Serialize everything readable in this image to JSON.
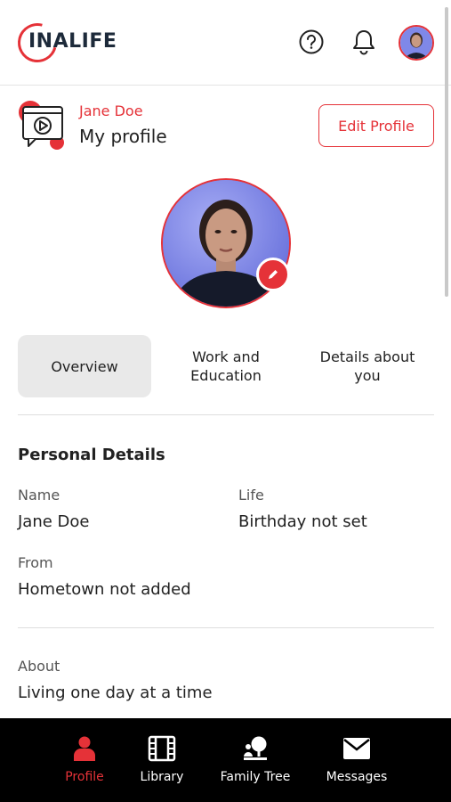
{
  "app": {
    "logo_text": "INALIFE"
  },
  "header": {
    "help_icon": "question-circle-icon",
    "notification_icon": "bell-icon"
  },
  "profile_header": {
    "user_name": "Jane Doe",
    "title": "My profile",
    "edit_button": "Edit Profile"
  },
  "tabs": [
    {
      "label": "Overview",
      "active": true
    },
    {
      "label": "Work and Education",
      "active": false
    },
    {
      "label": "Details about you",
      "active": false
    }
  ],
  "personal_details": {
    "title": "Personal Details",
    "name_label": "Name",
    "name_value": "Jane Doe",
    "life_label": "Life",
    "life_value": "Birthday not set",
    "from_label": "From",
    "from_value": "Hometown not added",
    "about_label": "About",
    "about_value": "Living one day at a time"
  },
  "bottom_nav": [
    {
      "label": "Profile",
      "icon": "person-icon",
      "active": true
    },
    {
      "label": "Library",
      "icon": "film-icon",
      "active": false
    },
    {
      "label": "Family Tree",
      "icon": "family-tree-icon",
      "active": false
    },
    {
      "label": "Messages",
      "icon": "envelope-icon",
      "active": false
    }
  ],
  "colors": {
    "accent": "#e53238",
    "nav_bg": "#000000",
    "tab_active_bg": "#e9e9e9"
  }
}
